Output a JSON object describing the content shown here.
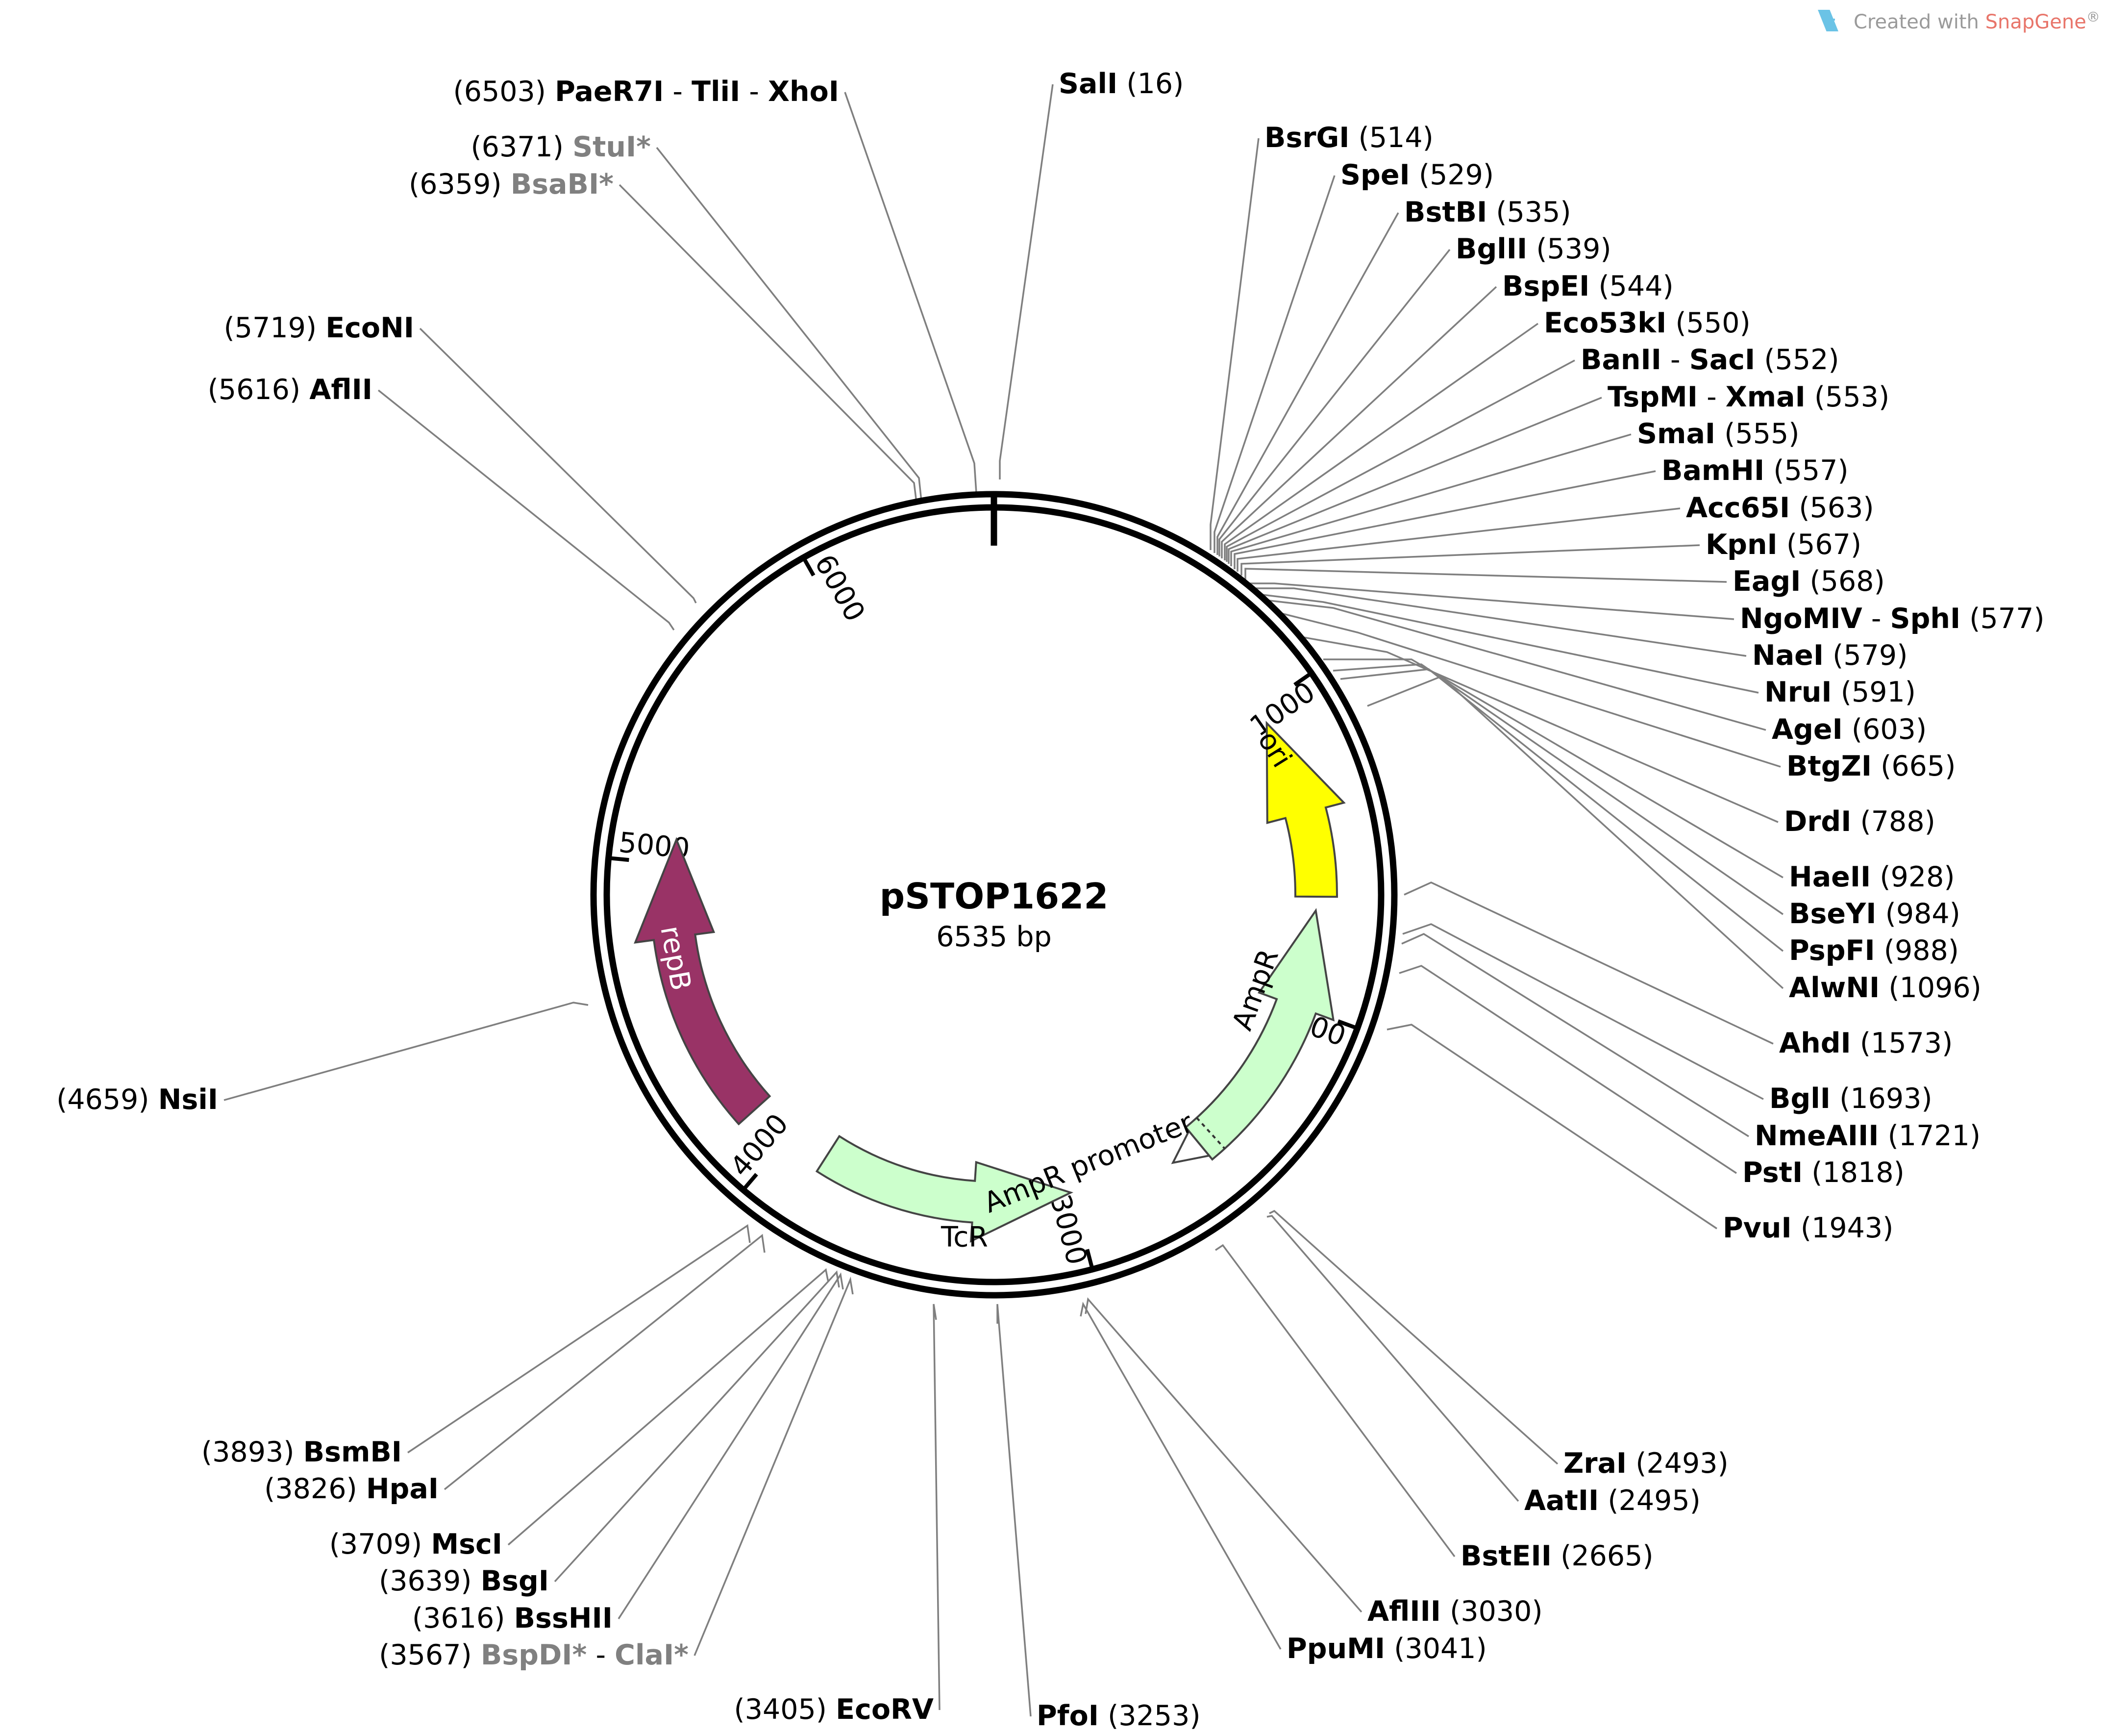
{
  "plasmid": {
    "name": "pSTOP1622",
    "size_label": "6535 bp",
    "length_bp": 6535
  },
  "watermark": {
    "prefix": "Created with ",
    "brand": "SnapGene",
    "suffix": "®",
    "brand_color": "#e8756a",
    "icon": "snapgene-logo-icon"
  },
  "ticks": [
    {
      "bp": 1000,
      "label": "1000"
    },
    {
      "bp": 2000,
      "label": "2000"
    },
    {
      "bp": 3000,
      "label": "3000"
    },
    {
      "bp": 4000,
      "label": "4000"
    },
    {
      "bp": 5000,
      "label": "5000"
    },
    {
      "bp": 6000,
      "label": "6000"
    }
  ],
  "features": [
    {
      "id": "ori",
      "label": "ori",
      "start": 1050,
      "end": 1640,
      "strand": "-",
      "color": "#ffff00",
      "label_color": "#000000"
    },
    {
      "id": "ampr",
      "label": "AmpR",
      "start": 1685,
      "end": 2550,
      "strand": "-",
      "color": "#ccffcc",
      "label_color": "#000000"
    },
    {
      "id": "ampr-promoter",
      "label": "AmpR promoter",
      "start": 2550,
      "end": 2655,
      "strand": "-",
      "color": "#ffffff",
      "label_color": "#000000"
    },
    {
      "id": "tcr",
      "label": "TcR",
      "start": 3005,
      "end": 3860,
      "strand": "-",
      "color": "#ccffcc",
      "label_color": "#000000"
    },
    {
      "id": "repb",
      "label": "repB",
      "start": 4140,
      "end": 5080,
      "strand": "+",
      "color": "#993366",
      "label_color": "#ffffff"
    }
  ],
  "sites": [
    {
      "parts": [
        {
          "t": "SalI"
        }
      ],
      "pos": "(16)",
      "side": "right"
    },
    {
      "parts": [
        {
          "t": "BsrGI"
        }
      ],
      "pos": "(514)",
      "side": "right"
    },
    {
      "parts": [
        {
          "t": "SpeI"
        }
      ],
      "pos": "(529)",
      "side": "right"
    },
    {
      "parts": [
        {
          "t": "BstBI"
        }
      ],
      "pos": "(535)",
      "side": "right"
    },
    {
      "parts": [
        {
          "t": "BglII"
        }
      ],
      "pos": "(539)",
      "side": "right"
    },
    {
      "parts": [
        {
          "t": "BspEI"
        }
      ],
      "pos": "(544)",
      "side": "right"
    },
    {
      "parts": [
        {
          "t": "Eco53kI"
        }
      ],
      "pos": "(550)",
      "side": "right"
    },
    {
      "parts": [
        {
          "t": "BanII"
        },
        {
          "t": "SacI"
        }
      ],
      "pos": "(552)",
      "side": "right"
    },
    {
      "parts": [
        {
          "t": "TspMI"
        },
        {
          "t": "XmaI"
        }
      ],
      "pos": "(553)",
      "side": "right"
    },
    {
      "parts": [
        {
          "t": "SmaI"
        }
      ],
      "pos": "(555)",
      "side": "right"
    },
    {
      "parts": [
        {
          "t": "BamHI"
        }
      ],
      "pos": "(557)",
      "side": "right"
    },
    {
      "parts": [
        {
          "t": "Acc65I"
        }
      ],
      "pos": "(563)",
      "side": "right"
    },
    {
      "parts": [
        {
          "t": "KpnI"
        }
      ],
      "pos": "(567)",
      "side": "right"
    },
    {
      "parts": [
        {
          "t": "EagI"
        }
      ],
      "pos": "(568)",
      "side": "right"
    },
    {
      "parts": [
        {
          "t": "NgoMIV"
        },
        {
          "t": "SphI"
        }
      ],
      "pos": "(577)",
      "side": "right"
    },
    {
      "parts": [
        {
          "t": "NaeI"
        }
      ],
      "pos": "(579)",
      "side": "right"
    },
    {
      "parts": [
        {
          "t": "NruI"
        }
      ],
      "pos": "(591)",
      "side": "right"
    },
    {
      "parts": [
        {
          "t": "AgeI"
        }
      ],
      "pos": "(603)",
      "side": "right"
    },
    {
      "parts": [
        {
          "t": "BtgZI"
        }
      ],
      "pos": "(665)",
      "side": "right"
    },
    {
      "parts": [
        {
          "t": "DrdI"
        }
      ],
      "pos": "(788)",
      "side": "right"
    },
    {
      "parts": [
        {
          "t": "HaeII"
        }
      ],
      "pos": "(928)",
      "side": "right"
    },
    {
      "parts": [
        {
          "t": "BseYI"
        }
      ],
      "pos": "(984)",
      "side": "right"
    },
    {
      "parts": [
        {
          "t": "PspFI"
        }
      ],
      "pos": "(988)",
      "side": "right"
    },
    {
      "parts": [
        {
          "t": "AlwNI"
        }
      ],
      "pos": "(1096)",
      "side": "right"
    },
    {
      "parts": [
        {
          "t": "AhdI"
        }
      ],
      "pos": "(1573)",
      "side": "right"
    },
    {
      "parts": [
        {
          "t": "BglI"
        }
      ],
      "pos": "(1693)",
      "side": "right"
    },
    {
      "parts": [
        {
          "t": "NmeAIII"
        }
      ],
      "pos": "(1721)",
      "side": "right"
    },
    {
      "parts": [
        {
          "t": "PstI"
        }
      ],
      "pos": "(1818)",
      "side": "right"
    },
    {
      "parts": [
        {
          "t": "PvuI"
        }
      ],
      "pos": "(1943)",
      "side": "right"
    },
    {
      "parts": [
        {
          "t": "ZraI"
        }
      ],
      "pos": "(2493)",
      "side": "right"
    },
    {
      "parts": [
        {
          "t": "AatII"
        }
      ],
      "pos": "(2495)",
      "side": "right"
    },
    {
      "parts": [
        {
          "t": "BstEII"
        }
      ],
      "pos": "(2665)",
      "side": "right"
    },
    {
      "parts": [
        {
          "t": "AflIII"
        }
      ],
      "pos": "(3030)",
      "side": "right"
    },
    {
      "parts": [
        {
          "t": "PpuMI"
        }
      ],
      "pos": "(3041)",
      "side": "right"
    },
    {
      "parts": [
        {
          "t": "PfoI"
        }
      ],
      "pos": "(3253)",
      "side": "right"
    },
    {
      "parts": [
        {
          "t": "EcoRV"
        }
      ],
      "pos": "(3405)",
      "side": "left"
    },
    {
      "parts": [
        {
          "t": "BspDI*",
          "grey": true
        },
        {
          "t": "ClaI*",
          "grey": true
        }
      ],
      "pos": "(3567)",
      "side": "left"
    },
    {
      "parts": [
        {
          "t": "BssHII"
        }
      ],
      "pos": "(3616)",
      "side": "left"
    },
    {
      "parts": [
        {
          "t": "BsgI"
        }
      ],
      "pos": "(3639)",
      "side": "left"
    },
    {
      "parts": [
        {
          "t": "MscI"
        }
      ],
      "pos": "(3709)",
      "side": "left"
    },
    {
      "parts": [
        {
          "t": "HpaI"
        }
      ],
      "pos": "(3826)",
      "side": "left"
    },
    {
      "parts": [
        {
          "t": "BsmBI"
        }
      ],
      "pos": "(3893)",
      "side": "left"
    },
    {
      "parts": [
        {
          "t": "NsiI"
        }
      ],
      "pos": "(4659)",
      "side": "left"
    },
    {
      "parts": [
        {
          "t": "AflII"
        }
      ],
      "pos": "(5616)",
      "side": "left"
    },
    {
      "parts": [
        {
          "t": "EcoNI"
        }
      ],
      "pos": "(5719)",
      "side": "left"
    },
    {
      "parts": [
        {
          "t": "BsaBI*",
          "grey": true
        }
      ],
      "pos": "(6359)",
      "side": "left"
    },
    {
      "parts": [
        {
          "t": "StuI*",
          "grey": true
        }
      ],
      "pos": "(6371)",
      "side": "left"
    },
    {
      "parts": [
        {
          "t": "PaeR7I"
        },
        {
          "t": "TliI"
        },
        {
          "t": "XhoI"
        }
      ],
      "pos": "(6503)",
      "side": "left"
    }
  ]
}
